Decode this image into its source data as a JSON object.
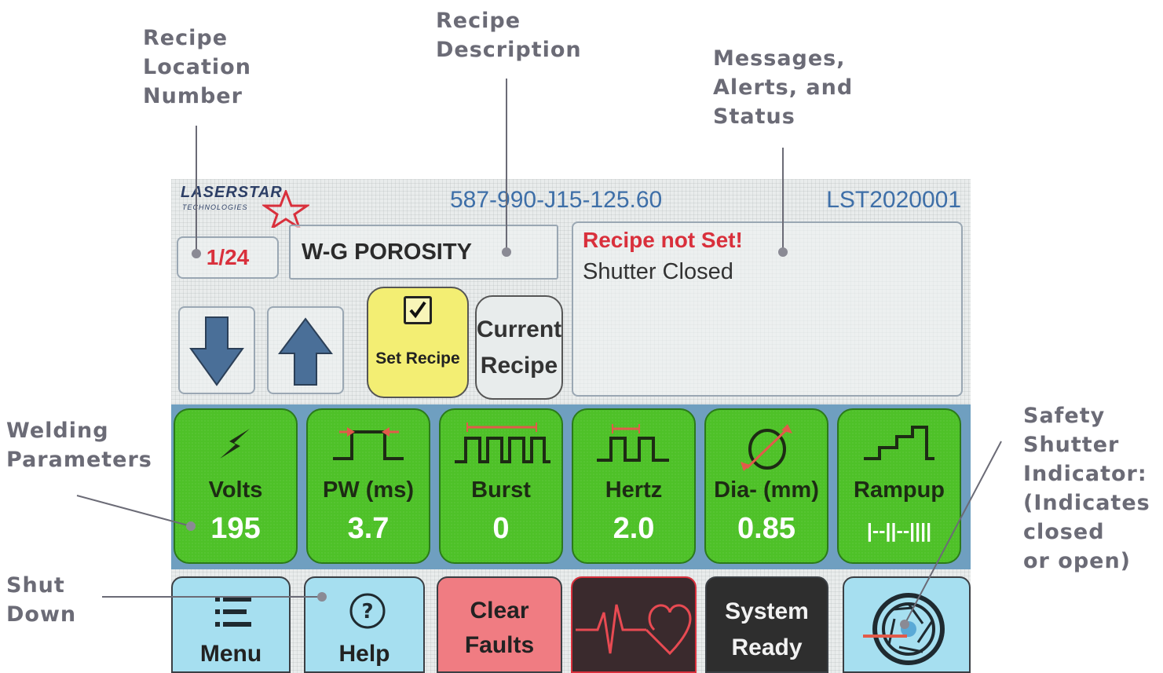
{
  "callouts": {
    "recipe_location": "Recipe\nLocation\nNumber",
    "recipe_description": "Recipe\nDescription",
    "messages": "Messages,\nAlerts, and\nStatus",
    "welding": "Welding\nParameters",
    "shutdown": "Shut\nDown",
    "safety": "Safety\nShutter\nIndicator:\n(Indicates\nclosed\nor open)"
  },
  "header": {
    "brand": "LASERSTAR",
    "brand_sub": "TECHNOLOGIES",
    "model_code": "587-990-J15-125.60",
    "serial": "LST2020001"
  },
  "recipe": {
    "location": "1/24",
    "description": "W-G POROSITY"
  },
  "messages": {
    "alert": "Recipe not Set!",
    "status": "Shutter Closed"
  },
  "buttons": {
    "set_recipe": "Set Recipe",
    "current_recipe": "Current Recipe"
  },
  "params": [
    {
      "name": "Volts",
      "value": "195"
    },
    {
      "name": "PW (ms)",
      "value": "3.7"
    },
    {
      "name": "Burst",
      "value": "0"
    },
    {
      "name": "Hertz",
      "value": "2.0"
    },
    {
      "name": "Dia- (mm)",
      "value": "0.85"
    },
    {
      "name": "Rampup",
      "value": "|--||--||||"
    }
  ],
  "bottom": {
    "menu": "Menu",
    "help": "Help",
    "clear_faults": "Clear Faults",
    "system_ready": "System Ready"
  },
  "colors": {
    "param_green": "#4ec128",
    "menu_cyan": "#a6dff0",
    "fault_red": "#f07c82",
    "set_recipe_yellow": "#f3ee73",
    "alert_red": "#d9303c",
    "arrow_blue": "#4a6f98"
  }
}
